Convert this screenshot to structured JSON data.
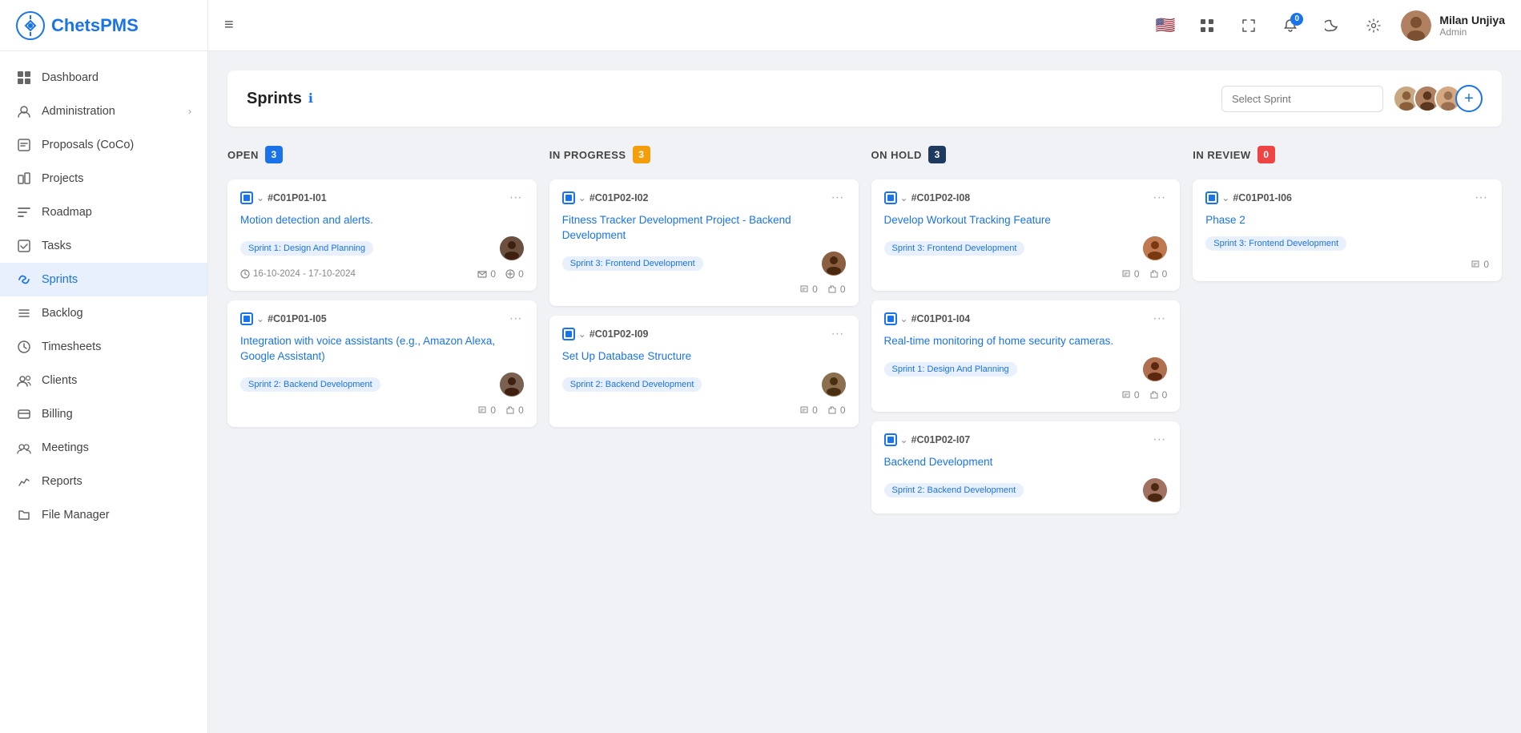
{
  "logo": {
    "text": "ChetsPMS"
  },
  "sidebar": {
    "items": [
      {
        "id": "dashboard",
        "label": "Dashboard",
        "icon": "dashboard"
      },
      {
        "id": "administration",
        "label": "Administration",
        "icon": "admin",
        "hasChevron": true
      },
      {
        "id": "proposals",
        "label": "Proposals (CoCo)",
        "icon": "proposals"
      },
      {
        "id": "projects",
        "label": "Projects",
        "icon": "projects"
      },
      {
        "id": "roadmap",
        "label": "Roadmap",
        "icon": "roadmap"
      },
      {
        "id": "tasks",
        "label": "Tasks",
        "icon": "tasks"
      },
      {
        "id": "sprints",
        "label": "Sprints",
        "icon": "sprints",
        "active": true
      },
      {
        "id": "backlog",
        "label": "Backlog",
        "icon": "backlog"
      },
      {
        "id": "timesheets",
        "label": "Timesheets",
        "icon": "timesheets"
      },
      {
        "id": "clients",
        "label": "Clients",
        "icon": "clients"
      },
      {
        "id": "billing",
        "label": "Billing",
        "icon": "billing"
      },
      {
        "id": "meetings",
        "label": "Meetings",
        "icon": "meetings"
      },
      {
        "id": "reports",
        "label": "Reports",
        "icon": "reports"
      },
      {
        "id": "file-manager",
        "label": "File Manager",
        "icon": "file-manager"
      }
    ]
  },
  "topbar": {
    "hamburger_icon": "≡",
    "notification_count": "0",
    "user": {
      "name": "Milan Unjiya",
      "role": "Admin"
    }
  },
  "page": {
    "title": "Sprints",
    "select_placeholder": "Select Sprint"
  },
  "columns": [
    {
      "id": "open",
      "title": "OPEN",
      "badge": "3",
      "badge_class": "badge-blue",
      "cards": [
        {
          "id": "card-c01p01-i01",
          "task_id": "#C01P01-I01",
          "title": "Motion detection and alerts.",
          "sprint_tag": "Sprint 1: Design And Planning",
          "date_range": "16-10-2024 - 17-10-2024",
          "comments": "0",
          "attachments": "0",
          "has_date": true
        },
        {
          "id": "card-c01p01-i05",
          "task_id": "#C01P01-I05",
          "title": "Integration with voice assistants (e.g., Amazon Alexa, Google Assistant)",
          "sprint_tag": "Sprint 2: Backend Development",
          "comments": "0",
          "attachments": "0",
          "has_date": false
        }
      ]
    },
    {
      "id": "in-progress",
      "title": "IN PROGRESS",
      "badge": "3",
      "badge_class": "badge-orange",
      "cards": [
        {
          "id": "card-c01p02-i02",
          "task_id": "#C01P02-I02",
          "title": "Fitness Tracker Development Project - Backend Development",
          "sprint_tag": "Sprint 3: Frontend Development",
          "comments": "0",
          "attachments": "0",
          "has_date": false
        },
        {
          "id": "card-c01p02-i09",
          "task_id": "#C01P02-I09",
          "title": "Set Up Database Structure",
          "sprint_tag": "Sprint 2: Backend Development",
          "comments": "0",
          "attachments": "0",
          "has_date": false
        }
      ]
    },
    {
      "id": "on-hold",
      "title": "ON HOLD",
      "badge": "3",
      "badge_class": "badge-navy",
      "cards": [
        {
          "id": "card-c01p02-i08",
          "task_id": "#C01P02-I08",
          "title": "Develop Workout Tracking Feature",
          "sprint_tag": "Sprint 3: Frontend Development",
          "comments": "0",
          "attachments": "0",
          "has_date": false
        },
        {
          "id": "card-c01p01-i04",
          "task_id": "#C01P01-I04",
          "title": "Real-time monitoring of home security cameras.",
          "sprint_tag": "Sprint 1: Design And Planning",
          "comments": "0",
          "attachments": "0",
          "has_date": false
        },
        {
          "id": "card-c01p02-i07",
          "task_id": "#C01P02-I07",
          "title": "Backend Development",
          "sprint_tag": "Sprint 2: Backend Development",
          "comments": "",
          "attachments": "",
          "has_date": false,
          "partial": true
        }
      ]
    },
    {
      "id": "in-review",
      "title": "IN REVIEW",
      "badge": "0",
      "badge_class": "badge-red",
      "cards": [
        {
          "id": "card-c01p01-i06",
          "task_id": "#C01P01-I06",
          "title": "Phase 2",
          "sprint_tag": "Sprint 3: Frontend Development",
          "comments": "0",
          "attachments": "",
          "has_date": false
        }
      ]
    }
  ]
}
